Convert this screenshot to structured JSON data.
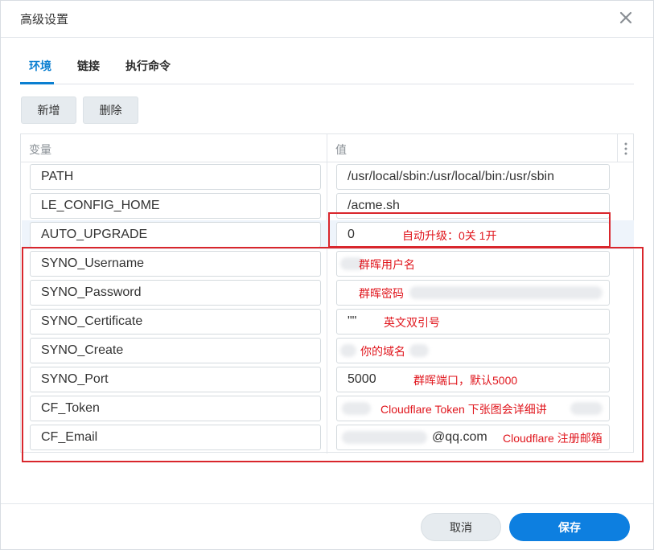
{
  "dialog": {
    "title": "高级设置"
  },
  "tabs": [
    {
      "label": "环境",
      "active": true
    },
    {
      "label": "链接",
      "active": false
    },
    {
      "label": "执行命令",
      "active": false
    }
  ],
  "toolbar": {
    "add_label": "新增",
    "delete_label": "删除"
  },
  "grid": {
    "col_variable": "变量",
    "col_value": "值",
    "rows": [
      {
        "key": "PATH",
        "value": "/usr/local/sbin:/usr/local/bin:/usr/sbin",
        "note": ""
      },
      {
        "key": "LE_CONFIG_HOME",
        "value": "/acme.sh",
        "note": ""
      },
      {
        "key": "AUTO_UPGRADE",
        "value": "0",
        "note": "自动升级：0关 1开"
      },
      {
        "key": "SYNO_Username",
        "value": "",
        "note": "群晖用户名"
      },
      {
        "key": "SYNO_Password",
        "value": "",
        "note": "群晖密码"
      },
      {
        "key": "SYNO_Certificate",
        "value": "\"\"",
        "note": "英文双引号"
      },
      {
        "key": "SYNO_Create",
        "value": "",
        "note": "你的域名"
      },
      {
        "key": "SYNO_Port",
        "value": "5000",
        "note": "群晖端口，默认5000"
      },
      {
        "key": "CF_Token",
        "value": "",
        "note": "Cloudflare Token 下张图会详细讲"
      },
      {
        "key": "CF_Email",
        "value": "@qq.com",
        "note": "Cloudflare 注册邮箱"
      }
    ]
  },
  "footer": {
    "cancel_label": "取消",
    "save_label": "保存"
  },
  "colors": {
    "accent": "#0d7fe0",
    "annotation": "#e0161d",
    "highlight_row": "#eef4fb"
  },
  "icons": {
    "close": "close-icon",
    "column_menu": "more-vertical-icon"
  }
}
